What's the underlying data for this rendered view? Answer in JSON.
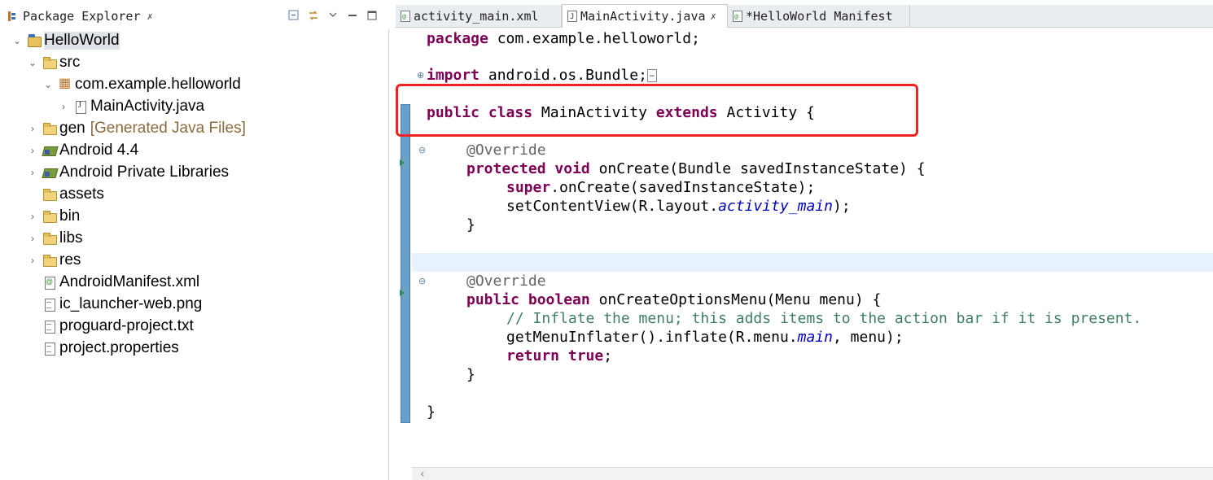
{
  "explorer": {
    "title": "Package Explorer",
    "close": "✗"
  },
  "tree": [
    {
      "label": "HelloWorld",
      "icon": "project-icon",
      "arrow": "⌄",
      "decor": ""
    },
    {
      "label": "src",
      "icon": "folder-icon",
      "arrow": "⌄",
      "decor": ""
    },
    {
      "label": "com.example.helloworld",
      "icon": "package-icon",
      "arrow": "⌄",
      "decor": ""
    },
    {
      "label": "MainActivity.java",
      "icon": "java-file-icon",
      "arrow": "›",
      "decor": ""
    },
    {
      "label": "gen",
      "icon": "folder-icon",
      "arrow": "›",
      "decor": "[Generated Java Files]"
    },
    {
      "label": "Android 4.4",
      "icon": "library-icon",
      "arrow": "›",
      "decor": ""
    },
    {
      "label": "Android Private Libraries",
      "icon": "library-icon",
      "arrow": "›",
      "decor": ""
    },
    {
      "label": "assets",
      "icon": "folder-icon",
      "arrow": "",
      "decor": ""
    },
    {
      "label": "bin",
      "icon": "folder-icon",
      "arrow": "›",
      "decor": ""
    },
    {
      "label": "libs",
      "icon": "folder-icon",
      "arrow": "›",
      "decor": ""
    },
    {
      "label": "res",
      "icon": "folder-icon",
      "arrow": "›",
      "decor": ""
    },
    {
      "label": "AndroidManifest.xml",
      "icon": "xml-file-icon",
      "arrow": "",
      "decor": ""
    },
    {
      "label": "ic_launcher-web.png",
      "icon": "file-icon",
      "arrow": "",
      "decor": ""
    },
    {
      "label": "proguard-project.txt",
      "icon": "file-icon",
      "arrow": "",
      "decor": ""
    },
    {
      "label": "project.properties",
      "icon": "file-icon",
      "arrow": "",
      "decor": ""
    }
  ],
  "editor_tabs": [
    {
      "label": "activity_main.xml",
      "close": ""
    },
    {
      "label": "MainActivity.java",
      "close": "✗"
    },
    {
      "label": "*HelloWorld Manifest",
      "close": ""
    }
  ],
  "code": {
    "package_kw": "package",
    "package_name": " com.example.helloworld;",
    "import_kw": "import",
    "import_name": " android.os.Bundle;",
    "import_fold": "…",
    "class_public": "public",
    "class_kw": "class",
    "class_name": " MainActivity ",
    "class_extends": "extends",
    "class_rest": " Activity {",
    "override": "@Override",
    "m1_protected": "protected",
    "m1_void": "void",
    "m1_rest": " onCreate(Bundle savedInstanceState) {",
    "m1_super": "super",
    "m1_super_rest": ".onCreate(savedInstanceState);",
    "m1_setcv": "setContentView(R.layout.",
    "m1_field": "activity_main",
    "m1_setcv_end": ");",
    "brace_close": "}",
    "m2_public": "public",
    "m2_boolean": "boolean",
    "m2_rest": " onCreateOptionsMenu(Menu menu) {",
    "m2_comment": "// Inflate the menu; this adds items to the action bar if it is present.",
    "m2_inflate": "getMenuInflater().inflate(R.menu.",
    "m2_field": "main",
    "m2_inflate_end": ", menu);",
    "m2_return": "return",
    "m2_true": "true",
    "m2_semicolon": ";",
    "class_close": "}"
  },
  "colors": {
    "keyword": "#7f0055",
    "annotation": "#646464",
    "field": "#0000c0",
    "comment": "#3f7f5f",
    "highlight_box": "#ee2222"
  }
}
